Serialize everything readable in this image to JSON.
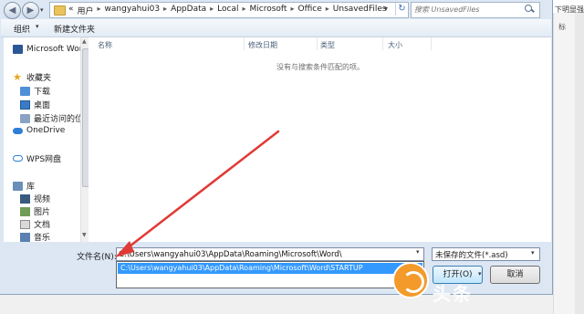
{
  "window": {
    "nav": {
      "back_glyph": "◀",
      "forward_glyph": "▶",
      "recent_glyph": "▾"
    },
    "breadcrumb": [
      "«",
      "用户",
      "wangyahui03",
      "AppData",
      "Local",
      "Microsoft",
      "Office",
      "UnsavedFiles"
    ],
    "breadcrumb_separator": "▸",
    "search_placeholder": "搜索 UnsavedFiles"
  },
  "toolbar": {
    "organize_label": "组织",
    "organize_arrow": "▾",
    "new_folder_label": "新建文件夹"
  },
  "sidebar": {
    "items": [
      {
        "label": "Microsoft Wor",
        "icon": "word-icon"
      },
      {
        "label": "收藏夹",
        "icon": "favorites-star-icon"
      },
      {
        "label": "下载",
        "icon": "downloads-folder-icon"
      },
      {
        "label": "桌面",
        "icon": "desktop-icon"
      },
      {
        "label": "最近访问的位",
        "icon": "recent-places-icon"
      },
      {
        "label": "OneDrive",
        "icon": "onedrive-cloud-icon"
      },
      {
        "label": "WPS网盘",
        "icon": "wps-cloud-icon"
      },
      {
        "label": "库",
        "icon": "library-icon"
      },
      {
        "label": "视频",
        "icon": "videos-icon"
      },
      {
        "label": "图片",
        "icon": "pictures-icon"
      },
      {
        "label": "文档",
        "icon": "documents-icon"
      },
      {
        "label": "音乐",
        "icon": "music-icon"
      }
    ]
  },
  "file_list": {
    "columns": [
      "名称",
      "修改日期",
      "类型",
      "大小"
    ],
    "empty_message": "没有与搜索条件匹配的项。"
  },
  "footer": {
    "filename_label": "文件名(N):",
    "filename_value": "C:\\Users\\wangyahui03\\AppData\\Roaming\\Microsoft\\Word\\",
    "filename_suggestion": "C:\\Users\\wangyahui03\\AppData\\Roaming\\Microsoft\\Word\\STARTUP",
    "filetype_value": "未保存的文件(*.asd)",
    "open_label": "打开(O)",
    "cancel_label": "取消"
  },
  "background_window": {
    "text": "下明显强调",
    "side_label": "标"
  },
  "annotation": {
    "arrow_color": "#e03a35"
  },
  "watermark": {
    "text": "头条",
    "badge_color": "#f39a2a"
  }
}
